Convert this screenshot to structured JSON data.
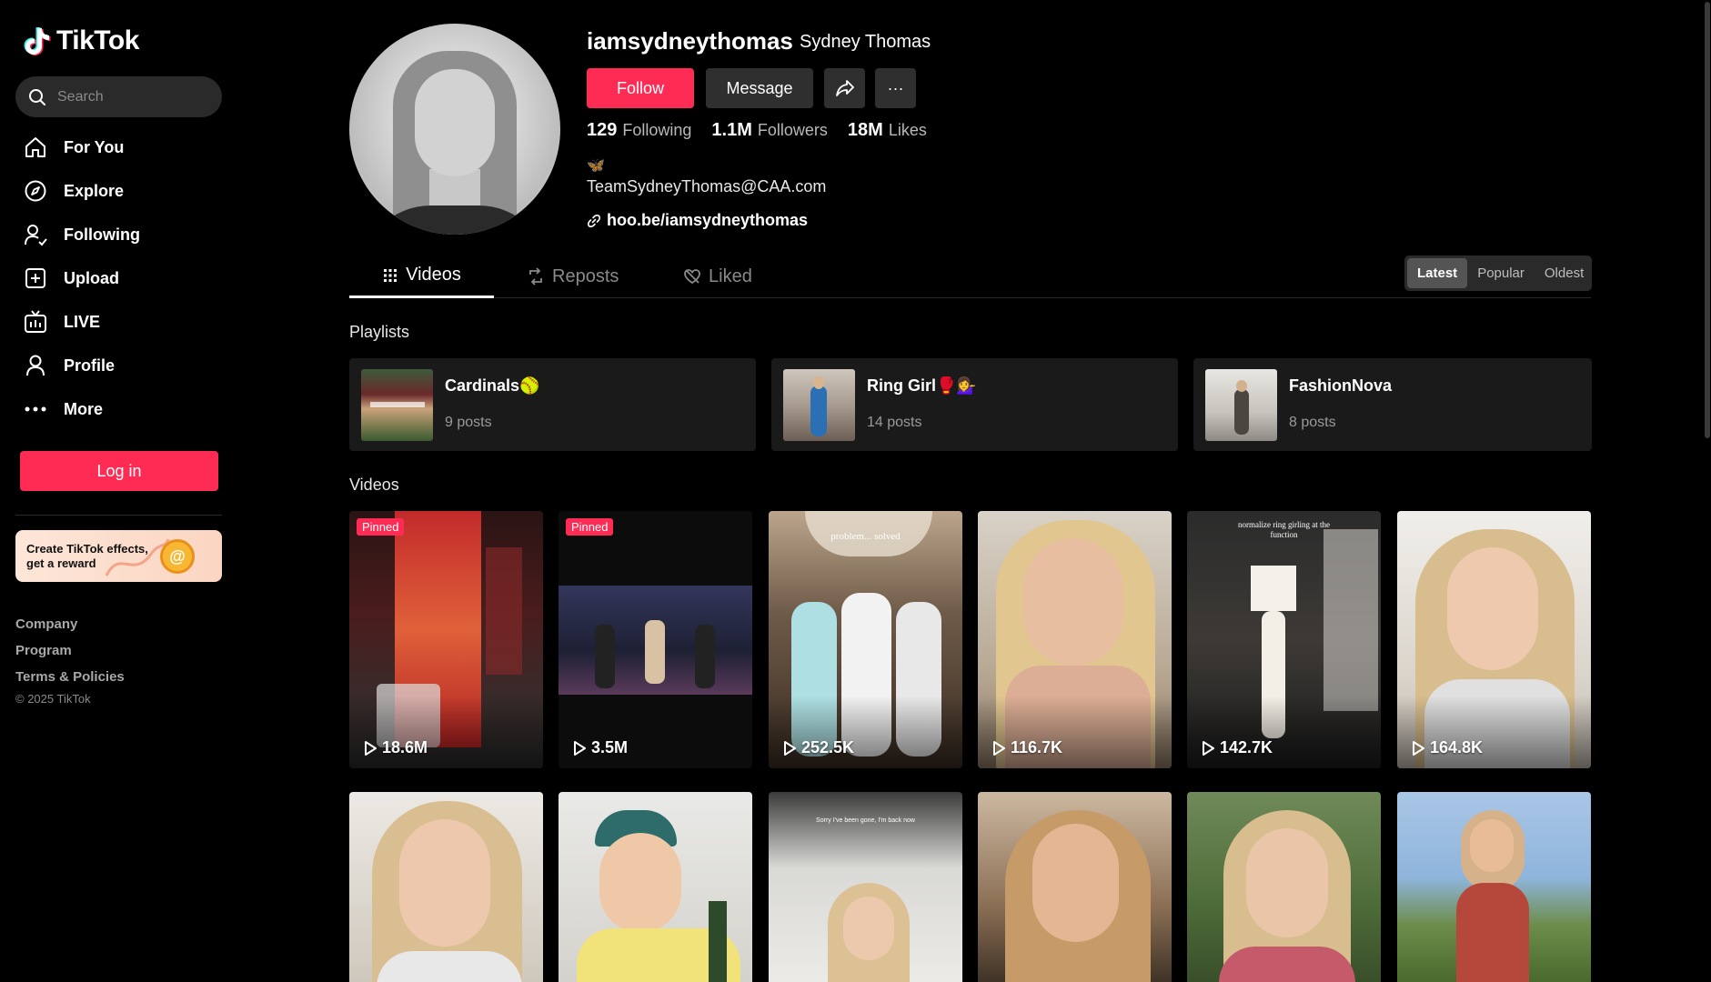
{
  "sidebar": {
    "brand": "TikTok",
    "search_placeholder": "Search",
    "nav": [
      {
        "label": "For You",
        "icon": "home-icon"
      },
      {
        "label": "Explore",
        "icon": "compass-icon"
      },
      {
        "label": "Following",
        "icon": "user-follow-icon"
      },
      {
        "label": "Upload",
        "icon": "upload-plus-icon"
      },
      {
        "label": "LIVE",
        "icon": "live-tv-icon"
      },
      {
        "label": "Profile",
        "icon": "profile-icon"
      },
      {
        "label": "More",
        "icon": "more-dots-icon"
      }
    ],
    "login_label": "Log in",
    "promo_text": "Create TikTok effects, get a reward",
    "footer_links": [
      "Company",
      "Program",
      "Terms & Policies"
    ],
    "copyright": "© 2025 TikTok"
  },
  "profile": {
    "username": "iamsydneythomas",
    "display_name": "Sydney Thomas",
    "follow_label": "Follow",
    "message_label": "Message",
    "more_label": "···",
    "stats": [
      {
        "num": "129",
        "label": "Following"
      },
      {
        "num": "1.1M",
        "label": "Followers"
      },
      {
        "num": "18M",
        "label": "Likes"
      }
    ],
    "bio_emoji": "🦋",
    "bio_email": "TeamSydneyThomas@CAA.com",
    "bio_link": "hoo.be/iamsydneythomas"
  },
  "tabs": [
    {
      "label": "Videos",
      "icon": "grid-icon"
    },
    {
      "label": "Reposts",
      "icon": "repost-icon"
    },
    {
      "label": "Liked",
      "icon": "heart-hidden-icon"
    }
  ],
  "sort": [
    "Latest",
    "Popular",
    "Oldest"
  ],
  "sections": {
    "playlists": "Playlists",
    "videos": "Videos"
  },
  "playlists": [
    {
      "name": "Cardinals🥎",
      "count": "9 posts"
    },
    {
      "name": "Ring Girl🥊💁‍♀️",
      "count": "14 posts"
    },
    {
      "name": "FashionNova",
      "count": "8 posts"
    }
  ],
  "videos": [
    {
      "views": "18.6M",
      "pinned": "Pinned"
    },
    {
      "views": "3.5M",
      "pinned": "Pinned"
    },
    {
      "views": "252.5K",
      "overlay": "problem... solved"
    },
    {
      "views": "116.7K"
    },
    {
      "views": "142.7K",
      "overlay": "normalize ring girling at the function"
    },
    {
      "views": "164.8K"
    },
    {
      "views": ""
    },
    {
      "views": ""
    },
    {
      "views": "",
      "overlay": "Sorry I've been gone, I'm back now"
    },
    {
      "views": ""
    },
    {
      "views": ""
    },
    {
      "views": ""
    }
  ],
  "colors": {
    "accent": "#fe2c55",
    "bg": "#000000",
    "surface": "#1a1a1a"
  }
}
